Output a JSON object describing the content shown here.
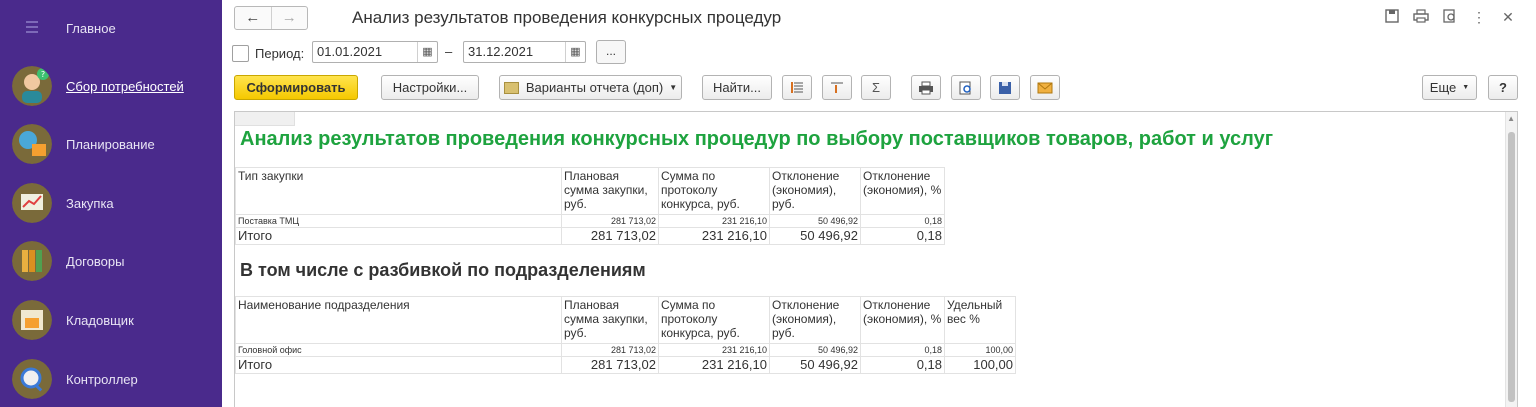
{
  "sidebar": {
    "items": [
      {
        "label": "Главное",
        "icon": "menu-icon"
      },
      {
        "label": "Сбор потребностей",
        "icon": "collector-icon",
        "active": true
      },
      {
        "label": "Планирование",
        "icon": "planning-icon"
      },
      {
        "label": "Закупка",
        "icon": "purchase-icon"
      },
      {
        "label": "Договоры",
        "icon": "contracts-icon"
      },
      {
        "label": "Кладовщик",
        "icon": "storekeeper-icon"
      },
      {
        "label": "Контроллер",
        "icon": "controller-icon"
      }
    ],
    "colors": {
      "background": "#4a2a8c",
      "text": "#e8e4f4"
    }
  },
  "header": {
    "title": "Анализ результатов проведения конкурсных процедур",
    "back_icon": "arrow-left-icon",
    "forward_icon": "arrow-right-icon"
  },
  "period": {
    "label": "Период:",
    "from": "01.01.2021",
    "to": "31.12.2021",
    "dash": "–",
    "more_label": "..."
  },
  "toolbar": {
    "generate_label": "Сформировать",
    "settings_label": "Настройки...",
    "variants_label": "Варианты отчета (доп)",
    "find_label": "Найти...",
    "more_label": "Еще",
    "help_label": "?"
  },
  "report": {
    "title": "Анализ результатов проведения конкурсных процедур по выбору поставщиков товаров, работ и услуг",
    "table1": {
      "headers": [
        "Тип закупки",
        "Плановая сумма закупки, руб.",
        "Сумма по протоколу конкурса, руб.",
        "Отклонение (экономия), руб.",
        "Отклонение (экономия), %"
      ],
      "rows": [
        [
          "Поставка ТМЦ",
          "281 713,02",
          "231 216,10",
          "50 496,92",
          "0,18"
        ]
      ],
      "total": [
        "Итого",
        "281 713,02",
        "231 216,10",
        "50 496,92",
        "0,18"
      ]
    },
    "subtitle": "В том числе с разбивкой по подразделениям",
    "table2": {
      "headers": [
        "Наименование подразделения",
        "Плановая сумма закупки, руб.",
        "Сумма по протоколу конкурса, руб.",
        "Отклонение (экономия), руб.",
        "Отклонение (экономия), %",
        "Удельный вес %"
      ],
      "rows": [
        [
          "Головной офис",
          "281 713,02",
          "231 216,10",
          "50 496,92",
          "0,18",
          "100,00"
        ]
      ],
      "total": [
        "Итого",
        "281 713,02",
        "231 216,10",
        "50 496,92",
        "0,18",
        "100,00"
      ]
    }
  },
  "colors": {
    "accent_title": "#1ea33f",
    "primary_button": "#f5c800"
  }
}
